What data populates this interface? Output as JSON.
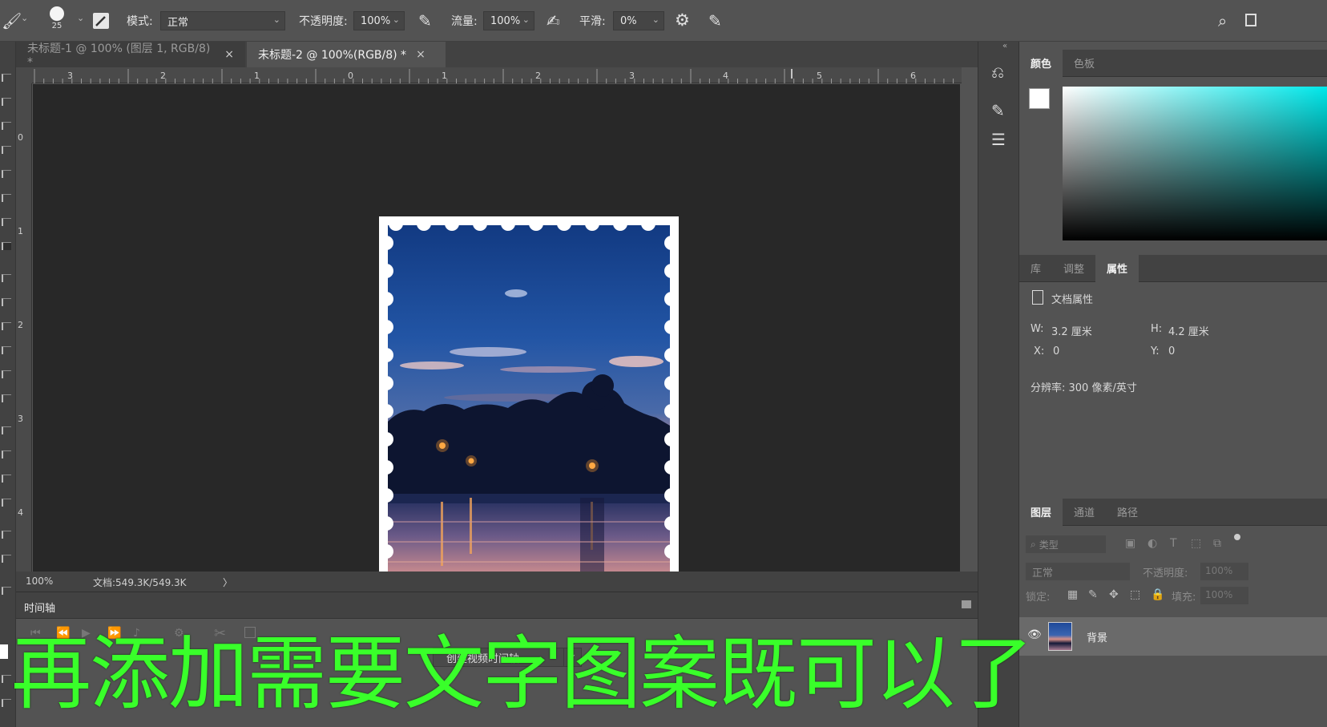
{
  "options_bar": {
    "brush_size": "25",
    "mode_label": "模式:",
    "mode_value": "正常",
    "opacity_label": "不透明度:",
    "opacity_value": "100%",
    "flow_label": "流量:",
    "flow_value": "100%",
    "smoothing_label": "平滑:",
    "smoothing_value": "0%"
  },
  "tabs": [
    {
      "label": "未标题-1 @ 100% (图层 1, RGB/8) *",
      "close": "×"
    },
    {
      "label": "未标题-2 @ 100%(RGB/8) *",
      "close": "×"
    }
  ],
  "ruler_h": [
    "3",
    "2",
    "1",
    "0",
    "1",
    "2",
    "3",
    "4",
    "5",
    "6"
  ],
  "ruler_v": [
    "0",
    "1",
    "2",
    "3",
    "4"
  ],
  "status": {
    "zoom": "100%",
    "doc_size": "文档:549.3K/549.3K",
    "arrow": "〉"
  },
  "timeline": {
    "title": "时间轴",
    "create_button": "创建视频时间轴"
  },
  "color_panel": {
    "tabs": [
      "颜色",
      "色板"
    ]
  },
  "properties_panel": {
    "tabs": [
      "库",
      "调整",
      "属性"
    ],
    "section_title": "文档属性",
    "w_label": "W:",
    "w_value": "3.2 厘米",
    "h_label": "H:",
    "h_value": "4.2 厘米",
    "x_label": "X:",
    "x_value": "0",
    "y_label": "Y:",
    "y_value": "0",
    "resolution": "分辨率: 300 像素/英寸"
  },
  "layers_panel": {
    "tabs": [
      "图层",
      "通道",
      "路径"
    ],
    "filter_label": "类型",
    "blend_mode": "正常",
    "opacity_label": "不透明度:",
    "opacity_value": "100%",
    "lock_label": "锁定:",
    "fill_label": "填充:",
    "fill_value": "100%",
    "layers": [
      {
        "name": "背景"
      }
    ]
  },
  "subtitle": "再添加需要文字图案既可以了"
}
